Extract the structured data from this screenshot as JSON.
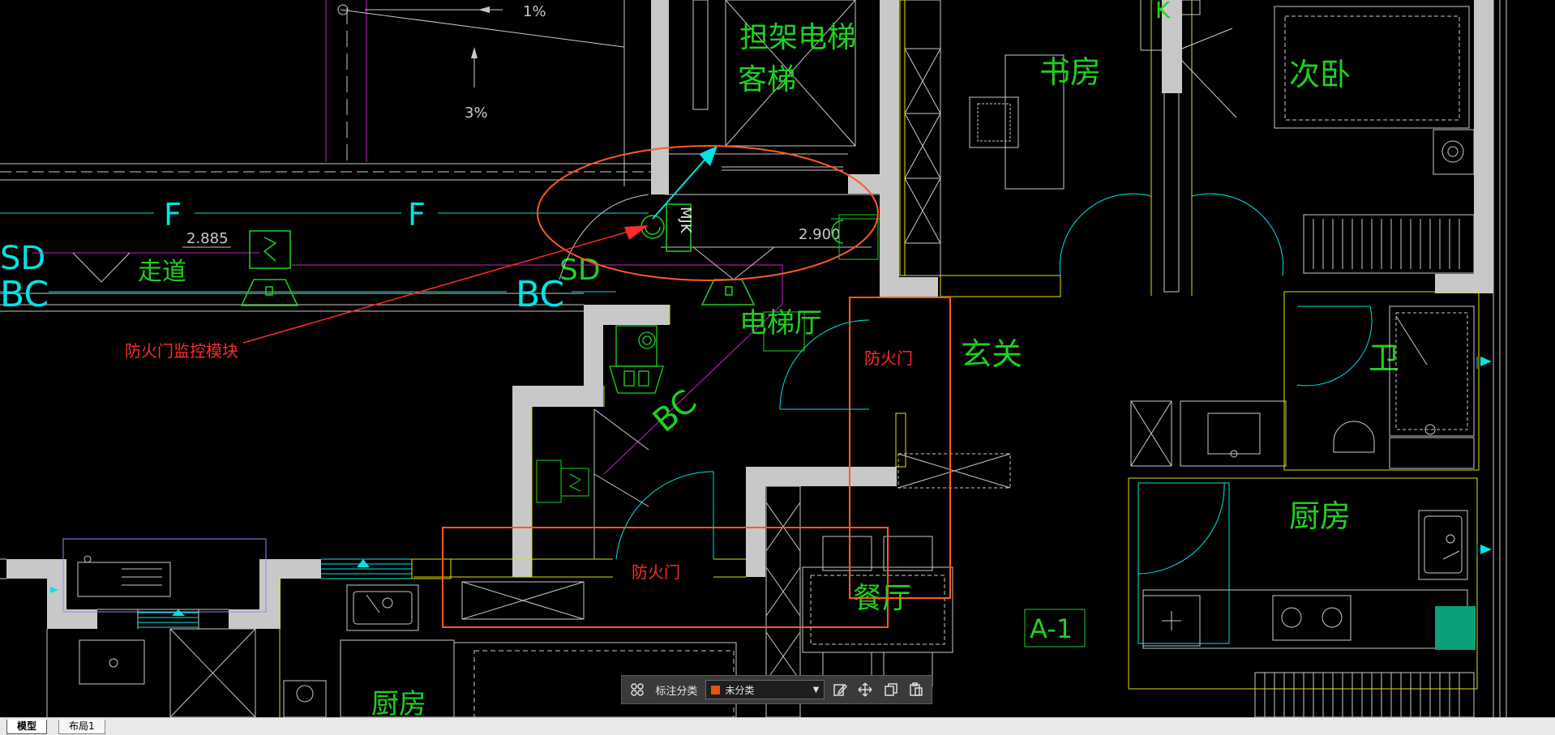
{
  "drawing": {
    "labels": {
      "slope_1": "1%",
      "slope_3": "3%",
      "elevator_line1": "担架电梯",
      "elevator_line2": "客梯",
      "study": "书房",
      "bedroom2": "次卧",
      "corridor": "走道",
      "level_left": "2.885",
      "level_right": "2.900",
      "mjk": "MJK",
      "f1": "F",
      "f2": "F",
      "sd1": "SD",
      "sd2": "SD",
      "bc1": "BC",
      "bc2": "BC",
      "bc3": "BC",
      "elevator_hall": "电梯厅",
      "entrance": "玄关",
      "bathroom": "卫",
      "kitchen_right": "厨房",
      "dining": "餐厅",
      "kitchen_left": "厨房",
      "unit": "A-1",
      "room_k": "K"
    },
    "annotations": {
      "monitor_module": "防火门监控模块",
      "fire_door_1": "防火门",
      "fire_door_2": "防火门"
    },
    "colors": {
      "background": "#000000",
      "wall_fill": "#c8c8c8",
      "cyan": "#00e5e5",
      "green": "#1fd11f",
      "magenta": "#d01fd0",
      "yellow": "#e0e000",
      "annotation_red": "#ff2a2a",
      "markup_orange": "#ff5a1f",
      "gray_line": "#8a8a8a"
    }
  },
  "toolbar": {
    "label": "标注分类",
    "category_value": "未分类",
    "icons": [
      "grid-icon",
      "edit-icon",
      "move-icon",
      "copy-icon",
      "paste-icon"
    ]
  },
  "tabs": {
    "model": "模型",
    "layout1": "布局1"
  }
}
